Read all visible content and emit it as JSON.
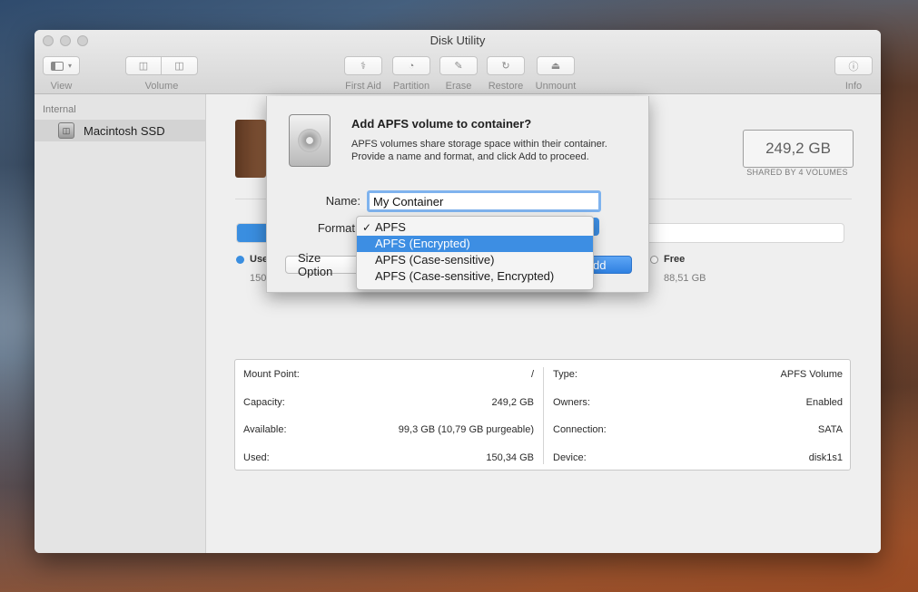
{
  "window": {
    "title": "Disk Utility"
  },
  "toolbar": {
    "view_label": "View",
    "volume_label": "Volume",
    "first_aid_label": "First Aid",
    "partition_label": "Partition",
    "erase_label": "Erase",
    "restore_label": "Restore",
    "unmount_label": "Unmount",
    "info_label": "Info"
  },
  "sidebar": {
    "section": "Internal",
    "items": [
      {
        "label": "Macintosh SSD",
        "selected": true
      }
    ]
  },
  "summary": {
    "capacity": "249,2 GB",
    "shared": "SHARED BY 4 VOLUMES",
    "used_fraction": 0.6,
    "legend": [
      {
        "name": "Use",
        "value": "150",
        "color": "#3a8ee0"
      },
      {
        "name": "Free",
        "value": "88,51 GB",
        "color": "#ffffff"
      }
    ]
  },
  "info": {
    "left": [
      {
        "key": "Mount Point:",
        "value": "/"
      },
      {
        "key": "Capacity:",
        "value": "249,2 GB"
      },
      {
        "key": "Available:",
        "value": "99,3 GB (10,79 GB purgeable)"
      },
      {
        "key": "Used:",
        "value": "150,34 GB"
      }
    ],
    "right": [
      {
        "key": "Type:",
        "value": "APFS Volume"
      },
      {
        "key": "Owners:",
        "value": "Enabled"
      },
      {
        "key": "Connection:",
        "value": "SATA"
      },
      {
        "key": "Device:",
        "value": "disk1s1"
      }
    ]
  },
  "dialog": {
    "title": "Add APFS volume to container?",
    "description": "APFS volumes share storage space within their container. Provide a name and format, and click Add to proceed.",
    "name_label": "Name:",
    "name_value": "My Container",
    "format_label": "Format",
    "format_options": [
      {
        "label": "APFS",
        "checked": true,
        "highlighted": false
      },
      {
        "label": "APFS (Encrypted)",
        "checked": false,
        "highlighted": true
      },
      {
        "label": "APFS (Case-sensitive)",
        "checked": false,
        "highlighted": false
      },
      {
        "label": "APFS (Case-sensitive, Encrypted)",
        "checked": false,
        "highlighted": false
      }
    ],
    "size_options_label": "Size Option",
    "add_label": "dd"
  },
  "colors": {
    "accent": "#3d8ee3",
    "window_bg": "#ececec"
  }
}
